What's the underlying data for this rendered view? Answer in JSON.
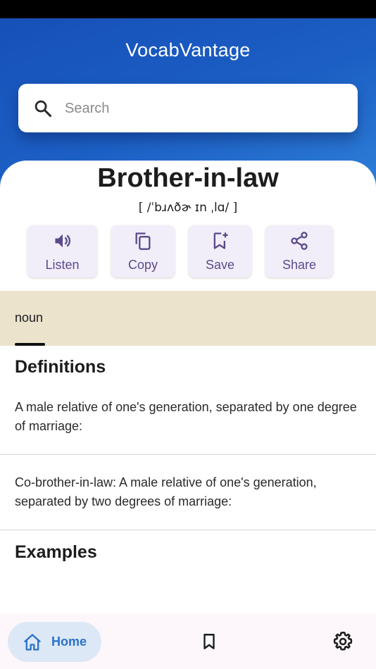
{
  "app": {
    "title": "VocabVantage"
  },
  "search": {
    "placeholder": "Search",
    "value": "",
    "icon": "search-icon"
  },
  "entry": {
    "word": "Brother-in-law",
    "phonetic": "[ /ˈbɹʌðɚ ɪn ˌlɑ/ ]",
    "part_of_speech": "noun"
  },
  "actions": [
    {
      "label": "Listen",
      "icon": "speaker-icon"
    },
    {
      "label": "Copy",
      "icon": "copy-icon"
    },
    {
      "label": "Save",
      "icon": "bookmark-add-icon"
    },
    {
      "label": "Share",
      "icon": "share-icon"
    }
  ],
  "definitions": {
    "heading": "Definitions",
    "items": [
      "A male relative of one's generation, separated by one degree of marriage:",
      "Co-brother-in-law: A male relative of one's generation, separated by two degrees of marriage:"
    ]
  },
  "examples": {
    "heading": "Examples"
  },
  "nav": {
    "home_label": "Home",
    "items": [
      "home-icon",
      "bookmark-icon",
      "settings-icon"
    ]
  },
  "colors": {
    "header_blue": "#1c5fc4",
    "action_bg": "#f2eef9",
    "action_text": "#5b4a8b",
    "pos_band": "#ece3cc",
    "nav_active_bg": "#dde8f6",
    "nav_active_text": "#2a72c8"
  }
}
